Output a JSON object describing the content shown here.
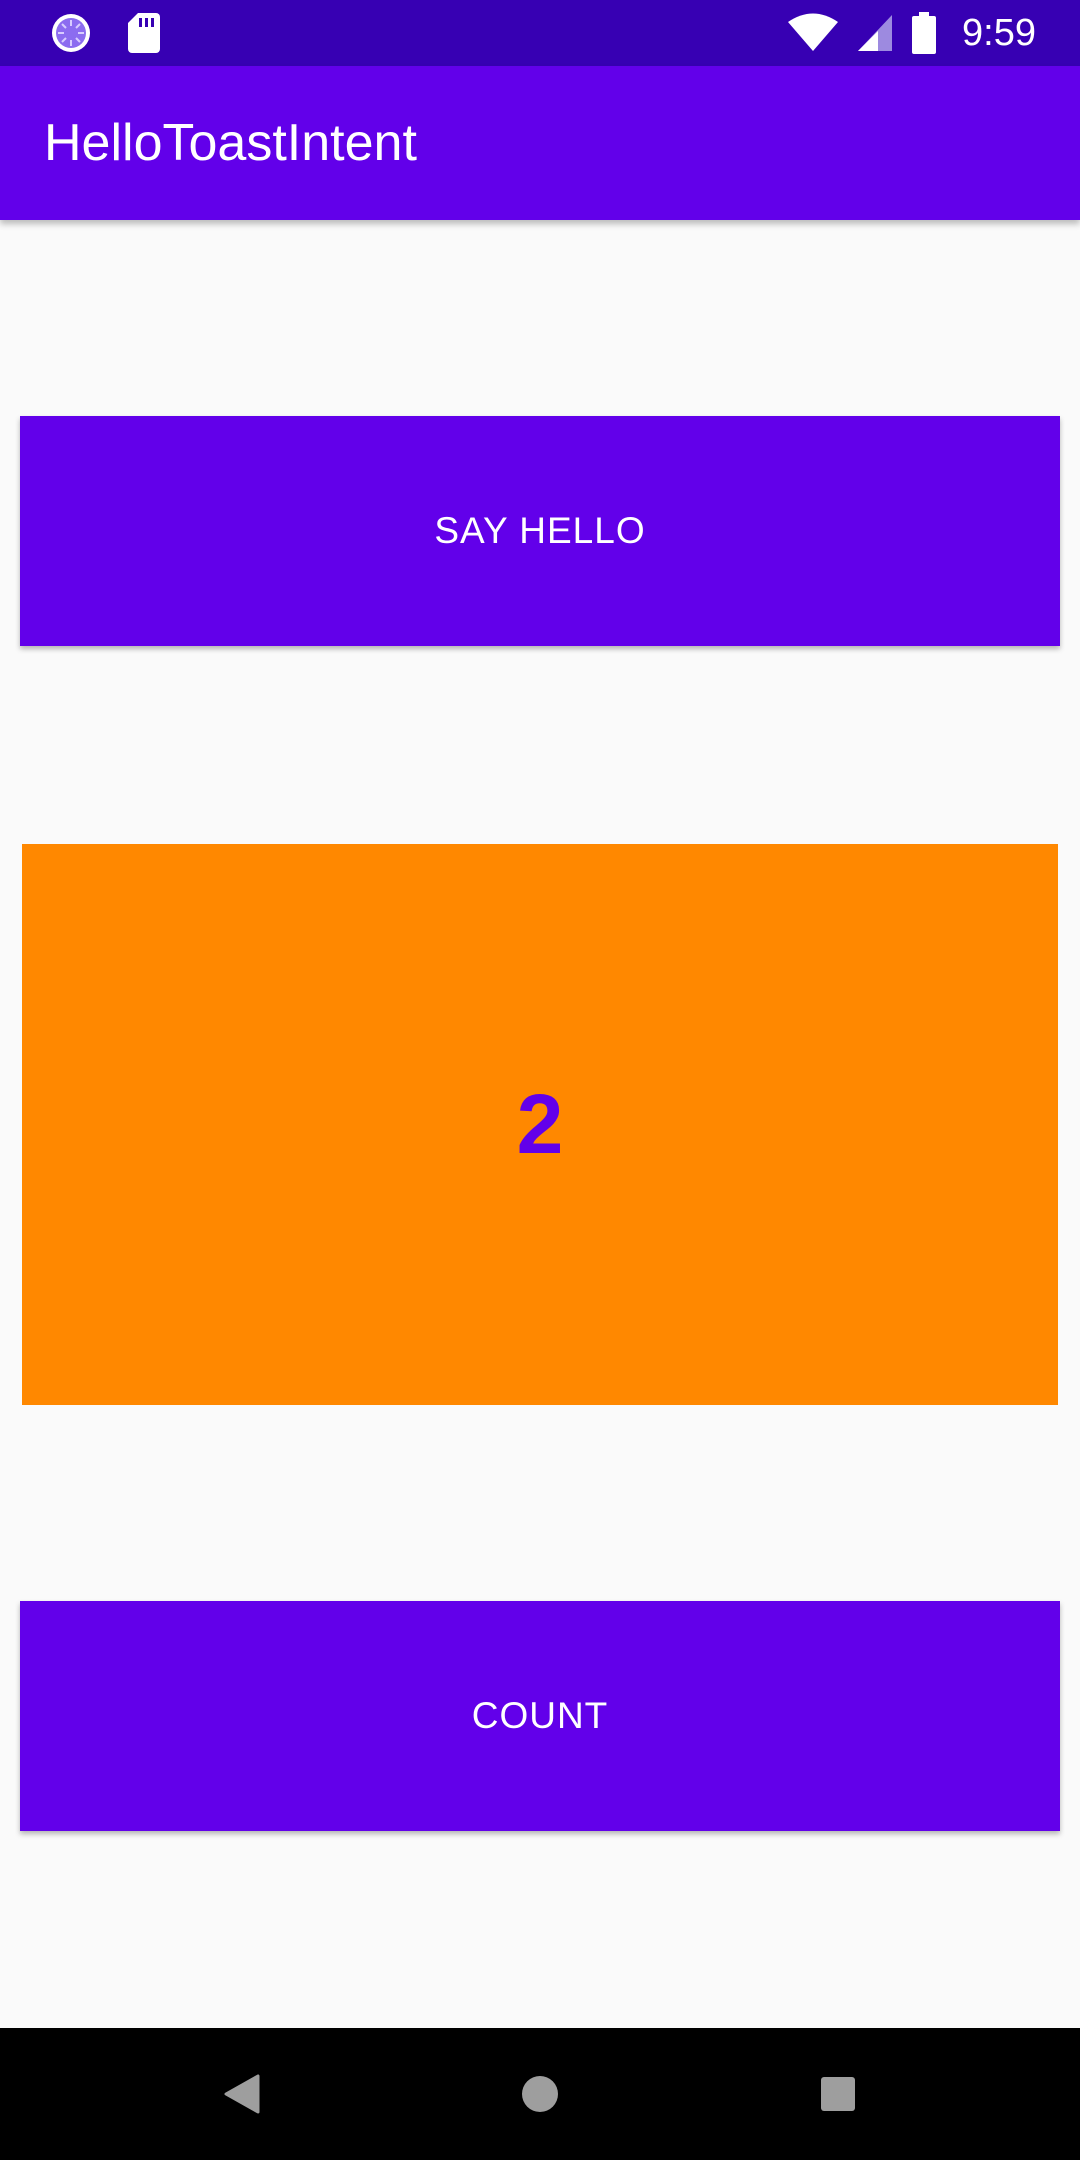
{
  "status_bar": {
    "time": "9:59",
    "icons": [
      "sync-icon",
      "sd-card-icon",
      "wifi-icon",
      "cell-signal-icon",
      "battery-icon"
    ],
    "background": "#3700b3"
  },
  "app_bar": {
    "title": "HelloToastIntent",
    "background": "#6200ea"
  },
  "main": {
    "say_hello_label": "SAY HELLO",
    "count_value": "2",
    "count_label": "COUNT",
    "button_color": "#6200ea",
    "count_box_color": "#ff8800",
    "count_text_color": "#6200ea"
  },
  "nav_bar": {
    "icons": [
      "back-icon",
      "home-icon",
      "recents-icon"
    ]
  }
}
